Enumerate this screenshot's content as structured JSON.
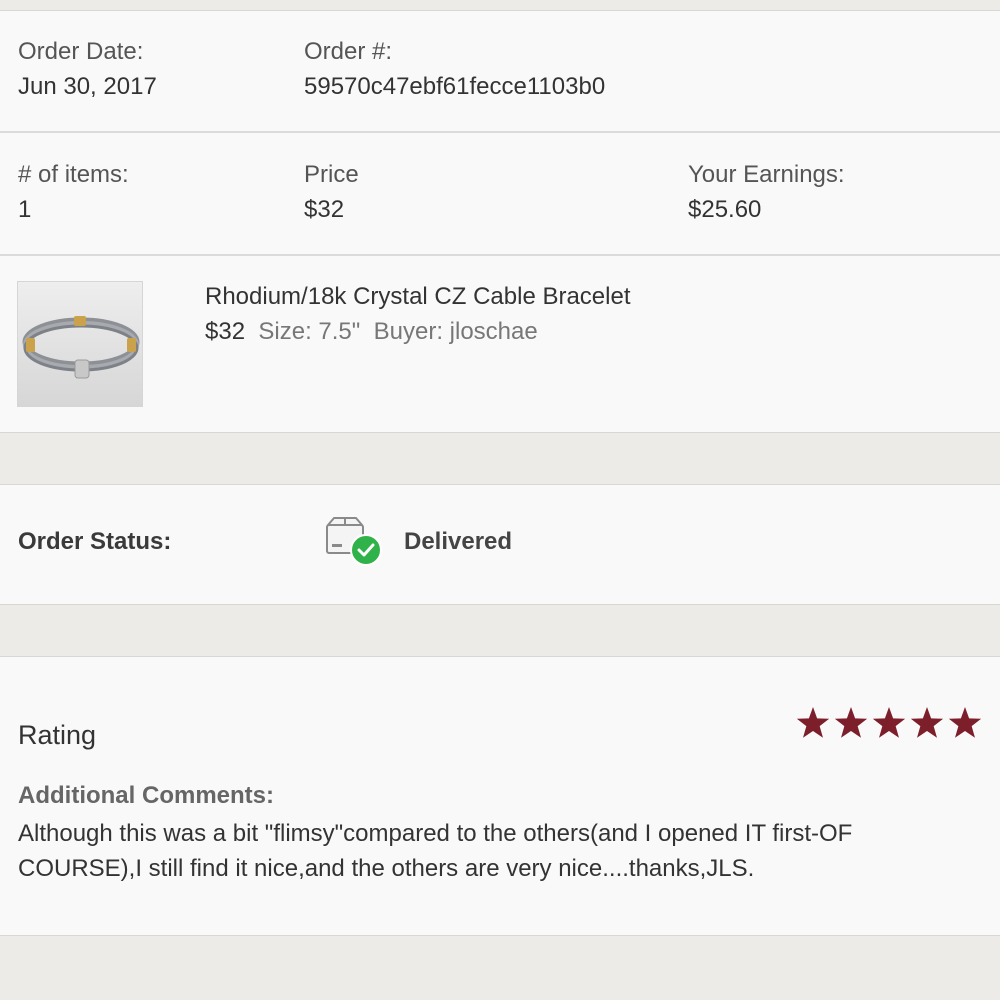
{
  "order": {
    "date_label": "Order Date:",
    "date_value": "Jun 30, 2017",
    "number_label": "Order #:",
    "number_value": "59570c47ebf61fecce1103b0"
  },
  "summary": {
    "items_label": "# of items:",
    "items_value": "1",
    "price_label": "Price",
    "price_value": "$32",
    "earnings_label": "Your Earnings:",
    "earnings_value": "$25.60"
  },
  "item": {
    "title": "Rhodium/18k Crystal CZ Cable Bracelet",
    "price": "$32",
    "size": "Size: 7.5\"",
    "buyer": "Buyer: jloschae",
    "thumbnail_icon": "bracelet-photo"
  },
  "status": {
    "label": "Order Status:",
    "value": "Delivered",
    "icon": "delivered-box-check-icon",
    "check_color": "#2fb24a"
  },
  "rating": {
    "label": "Rating",
    "stars": 5,
    "max_stars": 5,
    "star_color": "#7d1f2b",
    "comments_label": "Additional Comments:",
    "comments_text": "Although this was a bit \"flimsy\"compared to the others(and I opened IT first-OF COURSE),I still find it nice,and the others are very nice....thanks,JLS."
  }
}
